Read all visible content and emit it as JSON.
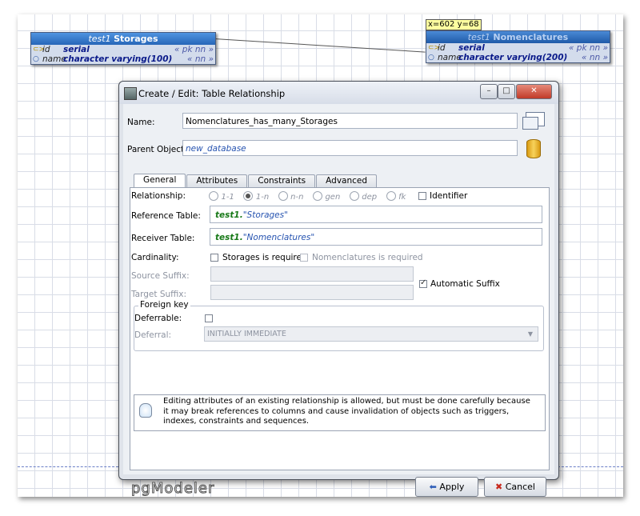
{
  "canvas": {
    "coord_label": "x=602 y=68",
    "tables": [
      {
        "schema": "test1",
        "name": "Storages",
        "columns": [
          {
            "icon": "pk-key-icon",
            "name": "id",
            "type": "serial",
            "constraints": "« pk nn »"
          },
          {
            "icon": "column-dot-icon",
            "name": "name",
            "type": "character varying(100)",
            "constraints": "« nn »"
          }
        ]
      },
      {
        "schema": "test1",
        "name": "Nomenclatures",
        "columns": [
          {
            "icon": "fk-key-icon",
            "name": "id",
            "type": "serial",
            "constraints": "« pk nn »"
          },
          {
            "icon": "column-dot-icon",
            "name": "name",
            "type": "character varying(200)",
            "constraints": "« nn »"
          }
        ]
      }
    ]
  },
  "dialog": {
    "title": "Create / Edit: Table Relationship",
    "name_label": "Name:",
    "name_value": "Nomenclatures_has_many_Storages",
    "parent_label": "Parent Object:",
    "parent_value": "new_database",
    "tabs": [
      "General",
      "Attributes",
      "Constraints",
      "Advanced"
    ],
    "general": {
      "relationship_label": "Relationship:",
      "rel_options": [
        "1-1",
        "1-n",
        "n-n",
        "gen",
        "dep",
        "fk"
      ],
      "identifier_label": "Identifier",
      "reference_label": "Reference Table:",
      "reference_schema": "test1.",
      "reference_table": "\"Storages\"",
      "receiver_label": "Receiver Table:",
      "receiver_schema": "test1.",
      "receiver_table": "\"Nomenclatures\"",
      "cardinality_label": "Cardinality:",
      "card_source": "Storages is required",
      "card_target": "Nomenclatures is required",
      "source_suffix_label": "Source Suffix:",
      "target_suffix_label": "Target Suffix:",
      "auto_suffix_label": "Automatic Suffix",
      "fk_group_label": "Foreign key",
      "deferrable_label": "Deferrable:",
      "deferral_label": "Deferral:",
      "deferral_value": "INITIALLY IMMEDIATE",
      "info_text": "Editing attributes of an existing relationship is allowed, but must be done carefully because it may break references to columns and cause invalidation of objects such as triggers, indexes, constraints and sequences."
    },
    "logo": "pgModeler",
    "apply_label": "Apply",
    "cancel_label": "Cancel"
  }
}
